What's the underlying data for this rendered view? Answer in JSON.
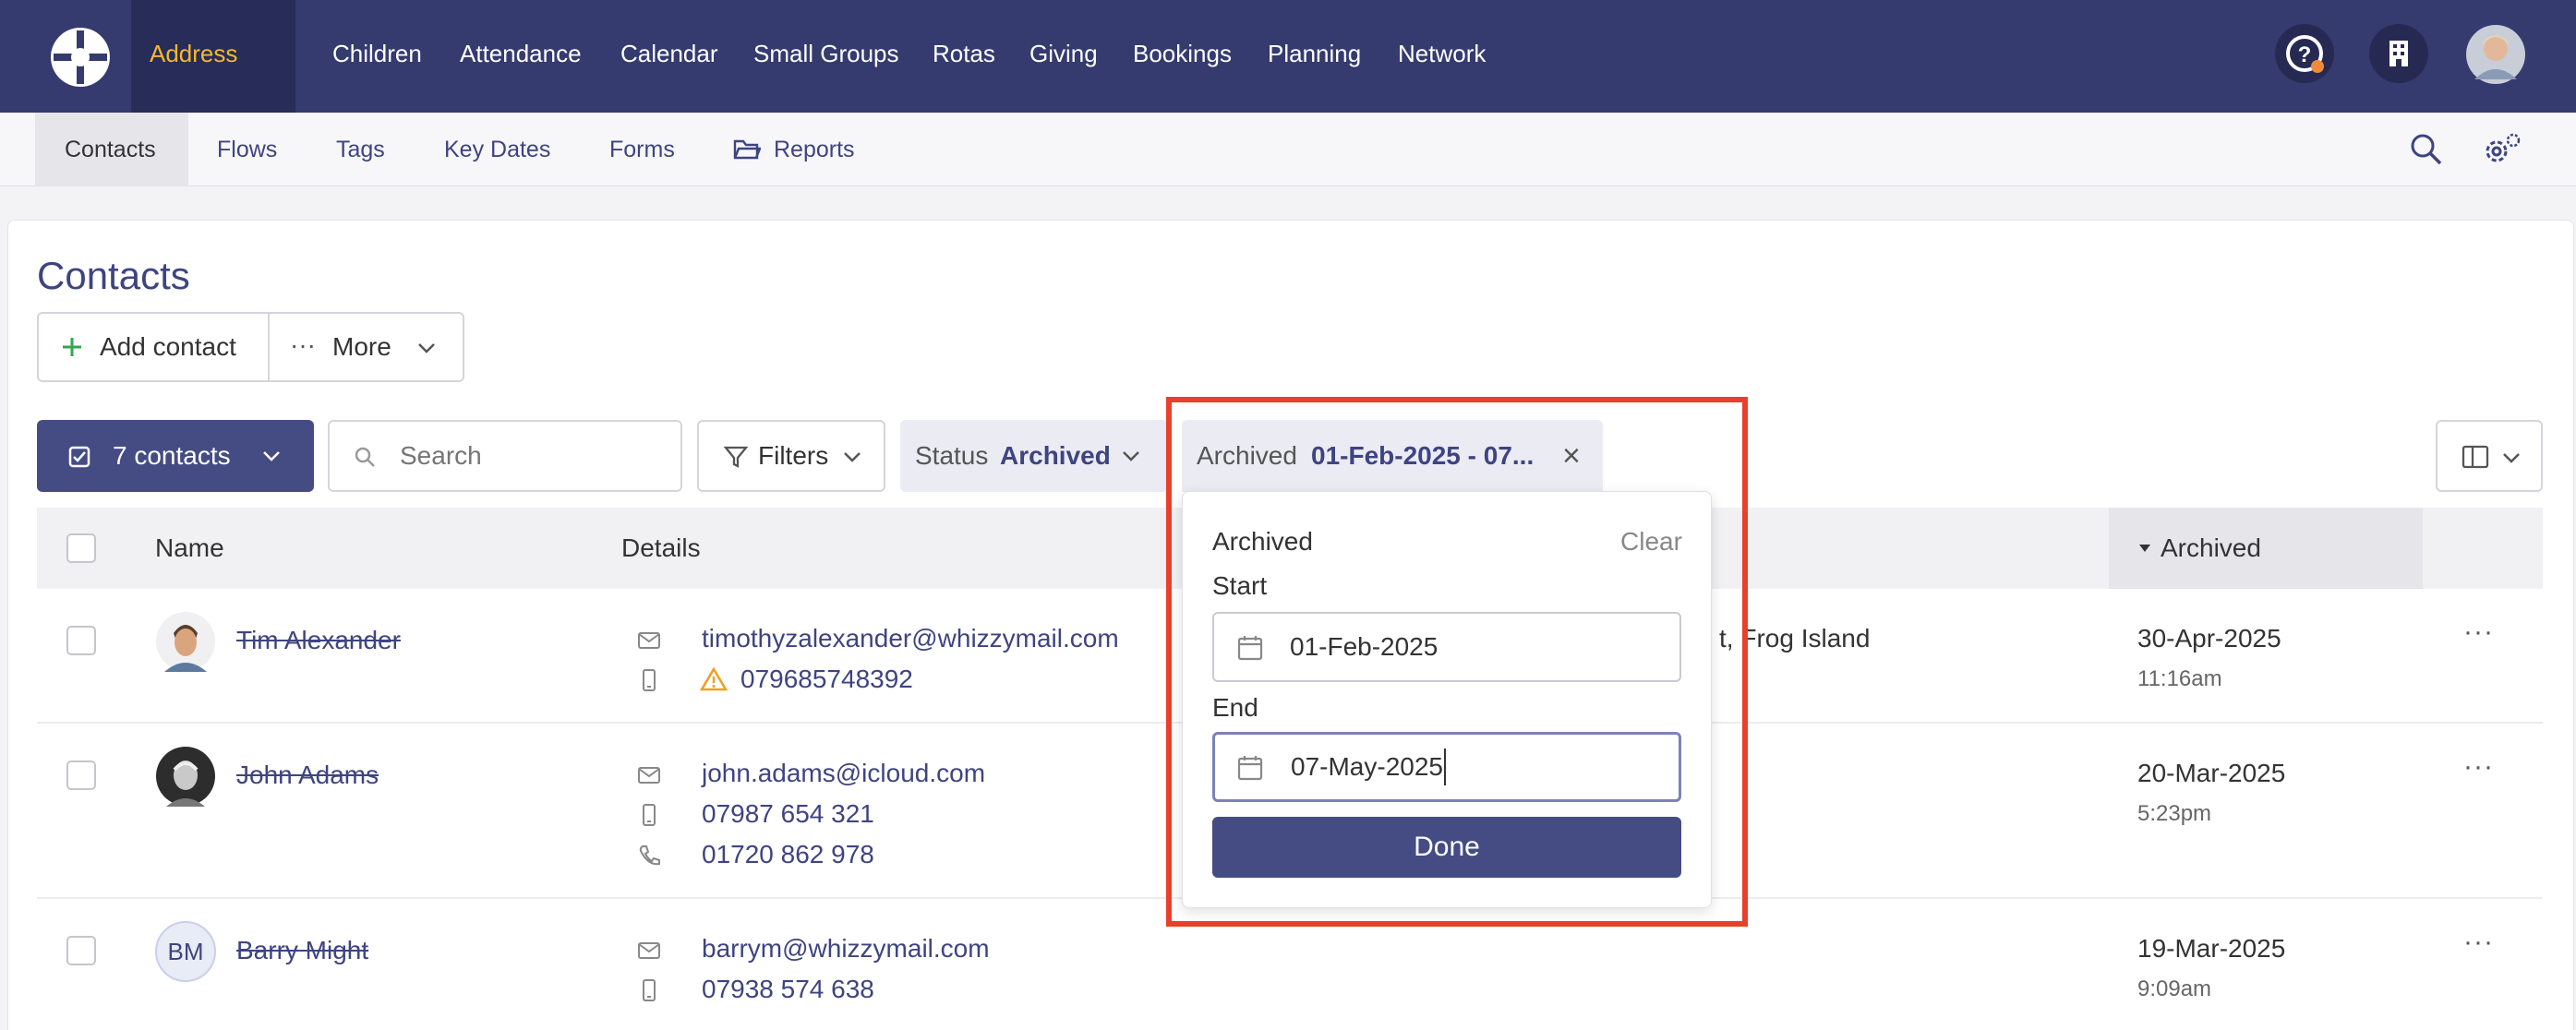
{
  "topnav": {
    "items": [
      {
        "label": "Address Book",
        "active": true
      },
      {
        "label": "Children"
      },
      {
        "label": "Attendance"
      },
      {
        "label": "Calendar"
      },
      {
        "label": "Small Groups"
      },
      {
        "label": "Rotas"
      },
      {
        "label": "Giving"
      },
      {
        "label": "Bookings"
      },
      {
        "label": "Planning"
      },
      {
        "label": "Network"
      }
    ],
    "icons": [
      "logo-icon",
      "help-icon",
      "building-icon",
      "avatar"
    ]
  },
  "subnav": {
    "items": [
      {
        "label": "Contacts",
        "active": true
      },
      {
        "label": "Flows"
      },
      {
        "label": "Tags"
      },
      {
        "label": "Key Dates"
      },
      {
        "label": "Forms"
      },
      {
        "label": "Reports"
      }
    ]
  },
  "page": {
    "title": "Contacts",
    "add_contact": "Add contact",
    "more": "More"
  },
  "filters": {
    "selection": "7 contacts",
    "search_placeholder": "Search",
    "filters_label": "Filters",
    "status_label": "Status",
    "status_value": "Archived",
    "archived_label": "Archived",
    "archived_value": "01-Feb-2025 - 07...",
    "remove": "×"
  },
  "table": {
    "headers": {
      "name": "Name",
      "details": "Details",
      "archived": "Archived"
    },
    "visible_location": "t, Frog Island",
    "rows": [
      {
        "name": "Tim Alexander",
        "email": "timothyzalexander@whizzymail.com",
        "mobile": "079685748392",
        "date": "30-Apr-2025",
        "time": "11:16am"
      },
      {
        "name": "John Adams",
        "email": "john.adams@icloud.com",
        "mobile": "07987 654 321",
        "phone": "01720 862 978",
        "date": "20-Mar-2025",
        "time": "5:23pm"
      },
      {
        "name": "Barry Might",
        "initials": "BM",
        "email": "barrym@whizzymail.com",
        "mobile": "07938 574 638",
        "date": "19-Mar-2025",
        "time": "9:09am"
      }
    ],
    "row_actions": "···"
  },
  "popup": {
    "heading": "Archived",
    "clear": "Clear",
    "start_label": "Start",
    "start_value": "01-Feb-2025",
    "end_label": "End",
    "end_value": "07-May-2025",
    "done": "Done"
  },
  "colors": {
    "nav_bg": "#353b6e",
    "active_nav_text": "#f5b731",
    "primary": "#454c84",
    "link": "#3e4480",
    "highlight": "#e8402b",
    "warning": "#f0a020"
  }
}
